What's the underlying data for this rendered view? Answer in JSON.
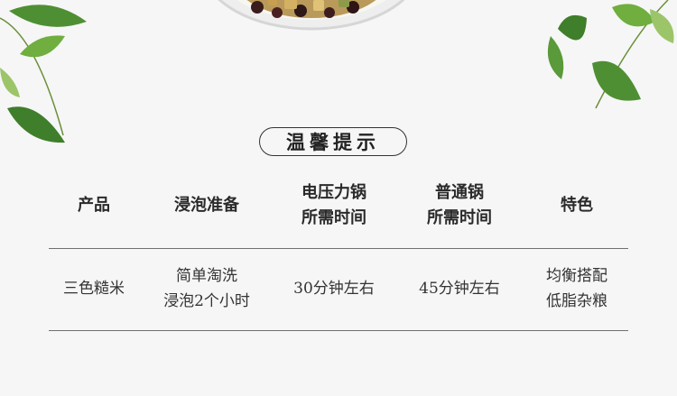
{
  "title": "温馨提示",
  "headers": [
    "产品",
    "浸泡准备",
    "电压力锅\n所需时间",
    "普通锅\n所需时间",
    "特色"
  ],
  "rows": [
    [
      "三色糙米",
      "简单淘洗\n浸泡2个小时",
      "30分钟左右",
      "45分钟左右",
      "均衡搭配\n低脂杂粮"
    ]
  ],
  "colors": {
    "leaf": "#5a9a3a",
    "leaf_light": "#9cc56a",
    "line": "#6f6f6f"
  },
  "icons": [
    "leaf-icon",
    "bowl-image"
  ]
}
